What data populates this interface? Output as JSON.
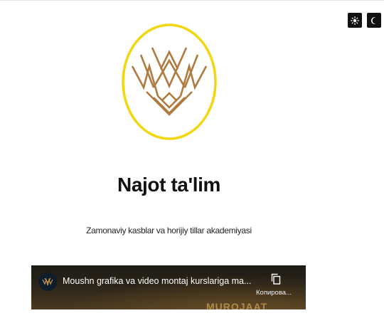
{
  "theme": {
    "light_icon": "sun-icon",
    "dark_icon": "moon-icon"
  },
  "brand": {
    "logo_icon": "crown-lotus-logo",
    "ring_color": "#f2d60f",
    "mark_color": "#b07a3f",
    "title": "Najot ta'lim",
    "tagline": "Zamonaviy kasblar va horijiy tillar akademiyasi"
  },
  "video": {
    "channel_avatar_icon": "najot-talim-channel-logo",
    "title": "Moushn grafika va video montaj kurslariga ma...",
    "copy_icon": "copy-icon",
    "copy_label": "Копирова...",
    "banner_text": "MUROJAAT"
  }
}
